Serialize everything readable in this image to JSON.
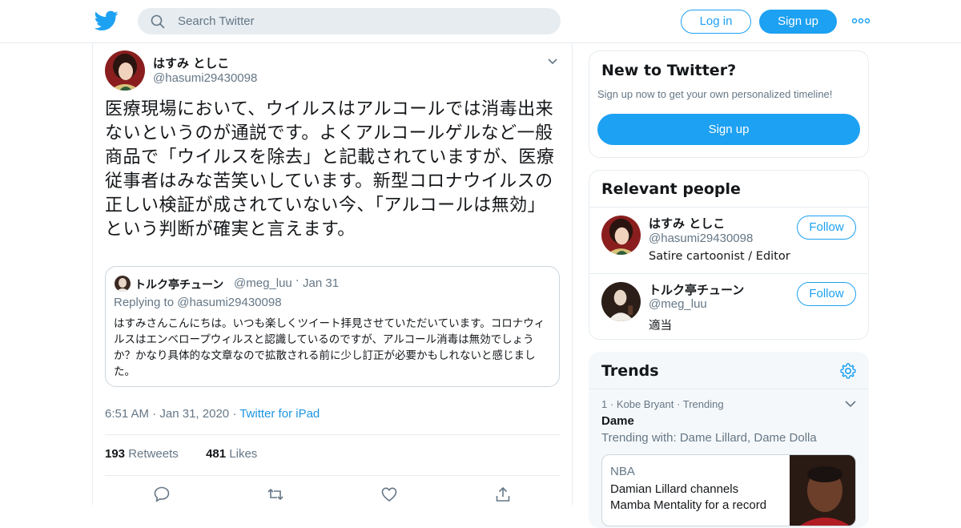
{
  "header": {
    "logo": "twitter-bird-icon",
    "search_placeholder": "Search Twitter",
    "login_label": "Log in",
    "signup_label": "Sign up",
    "more_icon": "more-dots-icon",
    "accent_color": "#1da1f2"
  },
  "tweet": {
    "author_name": "はすみ としこ",
    "author_handle": "@hasumi29430098",
    "text": "医療現場において、ウイルスはアルコールでは消毒出来ないというのが通説です。よくアルコールゲルなど一般商品で「ウイルスを除去」と記載されていますが、医療従事者はみな苦笑いしています。新型コロナウイルスの正しい検証が成されていない今、「アルコールは無効」という判断が確実と言えます。",
    "quote": {
      "name": "トルク亭チューン",
      "handle": "@meg_luu",
      "separator": "·",
      "date": "Jan 31",
      "replying_prefix": "Replying to",
      "replying_to": "@hasumi29430098",
      "text": "はすみさんこんにちは。いつも楽しくツイート拝見させていただいています。コロナウィルスはエンベロープウィルスと認識しているのですが、アルコール消毒は無効でしょうか？かなり具体的な文章なので拡散される前に少し訂正が必要かもしれないと感じました。"
    },
    "time": "6:51 AM",
    "date": "Jan 31, 2020",
    "separator": "·",
    "source": "Twitter for iPad",
    "retweets_count": "193",
    "retweets_label": "Retweets",
    "likes_count": "481",
    "likes_label": "Likes",
    "actions": [
      "reply-icon",
      "retweet-icon",
      "like-icon",
      "share-icon"
    ]
  },
  "sidebar": {
    "new_to_twitter": {
      "title": "New to Twitter?",
      "subtitle": "Sign up now to get your own personalized timeline!",
      "signup_label": "Sign up"
    },
    "relevant_people": {
      "title": "Relevant people",
      "people": [
        {
          "name": "はすみ としこ",
          "handle": "@hasumi29430098",
          "bio": "Satire cartoonist / Editor",
          "follow_label": "Follow"
        },
        {
          "name": "トルク亭チューン",
          "handle": "@meg_luu",
          "bio": "適当",
          "follow_label": "Follow"
        }
      ]
    },
    "trends": {
      "title": "Trends",
      "items": [
        {
          "rank": "1",
          "separator": "·",
          "context": "Kobe Bryant",
          "status": "Trending",
          "name": "Dame",
          "trending_with": "Trending with: Dame Lillard, Dame Dolla",
          "story_source": "NBA",
          "story_headline": "Damian Lillard channels Mamba Mentality for a record"
        }
      ]
    }
  }
}
